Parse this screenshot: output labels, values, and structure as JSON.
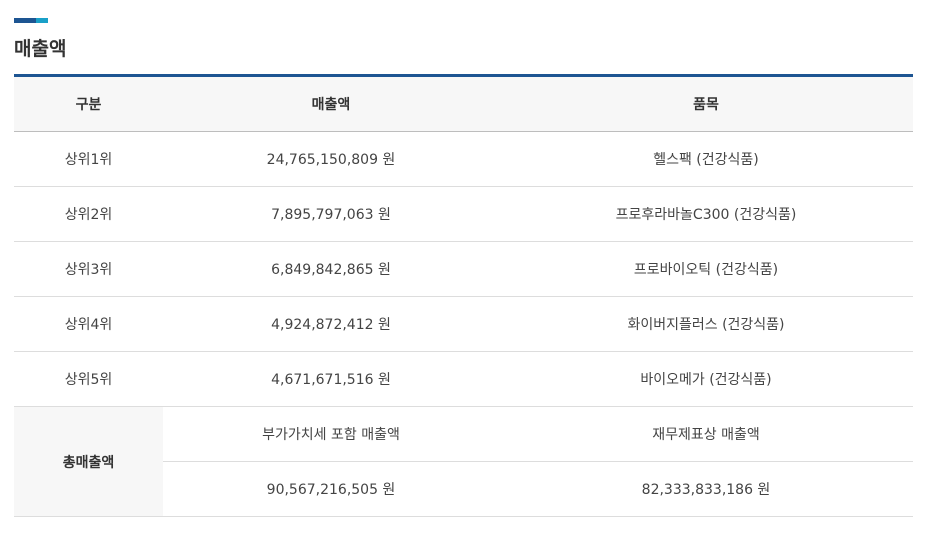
{
  "section": {
    "title": "매출액"
  },
  "table": {
    "headers": [
      "구분",
      "매출액",
      "품목"
    ],
    "rows": [
      {
        "rank": "상위1위",
        "amount": "24,765,150,809 원",
        "item": "헬스팩 (건강식품)"
      },
      {
        "rank": "상위2위",
        "amount": "7,895,797,063 원",
        "item": "프로후라바놀C300 (건강식품)"
      },
      {
        "rank": "상위3위",
        "amount": "6,849,842,865 원",
        "item": "프로바이오틱 (건강식품)"
      },
      {
        "rank": "상위4위",
        "amount": "4,924,872,412 원",
        "item": "화이버지플러스 (건강식품)"
      },
      {
        "rank": "상위5위",
        "amount": "4,671,671,516 원",
        "item": "바이오메가 (건강식품)"
      }
    ],
    "total": {
      "label": "총매출액",
      "vat_included_label": "부가가치세 포함 매출액",
      "financial_label": "재무제표상 매출액",
      "vat_included_amount": "90,567,216,505 원",
      "financial_amount": "82,333,833,186 원"
    }
  },
  "colors": {
    "accent_dark": "#1d5592",
    "accent_light": "#19a0c8",
    "header_bg": "#f7f7f7"
  }
}
